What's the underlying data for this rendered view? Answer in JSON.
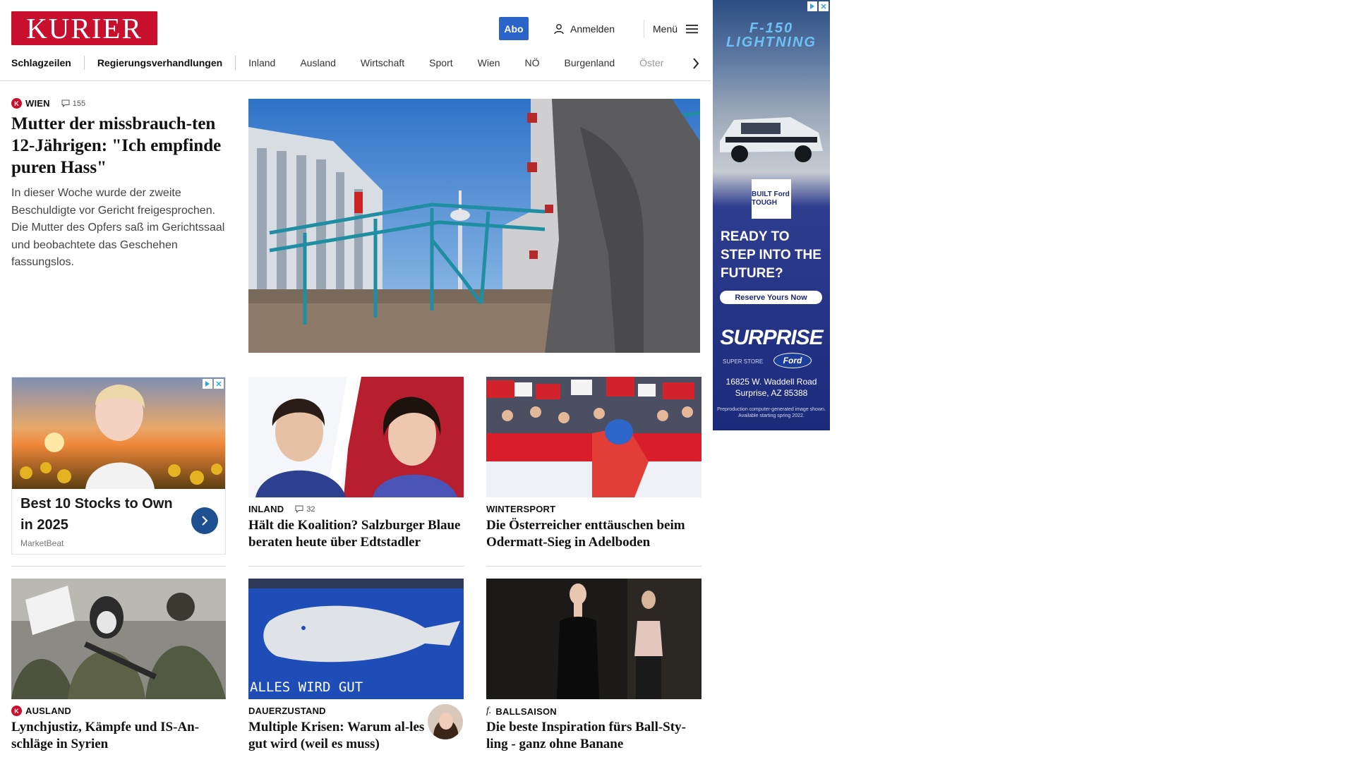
{
  "header": {
    "logo": "KURIER",
    "abo": "Abo",
    "login": "Anmelden",
    "menu": "Menü"
  },
  "nav": {
    "items": [
      "Schlagzeilen",
      "Regierungsverhandlungen",
      "Inland",
      "Ausland",
      "Wirtschaft",
      "Sport",
      "Wien",
      "NÖ",
      "Burgenland",
      "Öster"
    ]
  },
  "hero": {
    "badge": "K",
    "section": "WIEN",
    "comments": "155",
    "title": "Mutter der missbrauch-ten 12-Jährigen: \"Ich empfinde puren Hass\"",
    "description": "In dieser Woche wurde der zweite Beschuldigte vor Gericht freigesprochen. Die Mutter des Opfers saß im Gerichtssaal und beobachtete das Geschehen fassungslos."
  },
  "ad_card": {
    "title": "Best 10 Stocks to Own in 2025",
    "source": "MarketBeat"
  },
  "cards": [
    {
      "section": "INLAND",
      "comments": "32",
      "title": "Hält die Koalition? Salzburger Blaue beraten heute über Edtstadler"
    },
    {
      "section": "WINTERSPORT",
      "title": "Die Österreicher enttäuschen beim Odermatt-Sieg in Adelboden"
    },
    {
      "badge": "K",
      "section": "AUSLAND",
      "title": "Lynchjustiz, Kämpfe und IS-An-schläge in Syrien"
    },
    {
      "section": "DAUERZUSTAND",
      "title": "Multiple Krisen: Warum al-les gut wird (weil es muss)",
      "image_text": "ALLES WIRD GUT"
    },
    {
      "badge": "f.",
      "section": "BALLSAISON",
      "title": "Die beste Inspiration fürs Ball-Sty-ling - ganz ohne Banane"
    }
  ],
  "side_ad": {
    "headline": "F-150 LIGHTNING",
    "built": "BUILT Ford TOUGH",
    "tagline": "READY TO STEP INTO THE FUTURE?",
    "cta": "Reserve Yours Now",
    "dealer": "SURPRISE",
    "dealer_sub": "SUPER STORE",
    "brand": "Ford",
    "address": "16825 W. Waddell Road Surprise, AZ 85388",
    "fine_print": "Preproduction computer-generated image shown. Available starting spring 2022."
  },
  "colors": {
    "brand": "#c8102e",
    "abo": "#2a64c8",
    "ad_button": "#1d4f91"
  }
}
